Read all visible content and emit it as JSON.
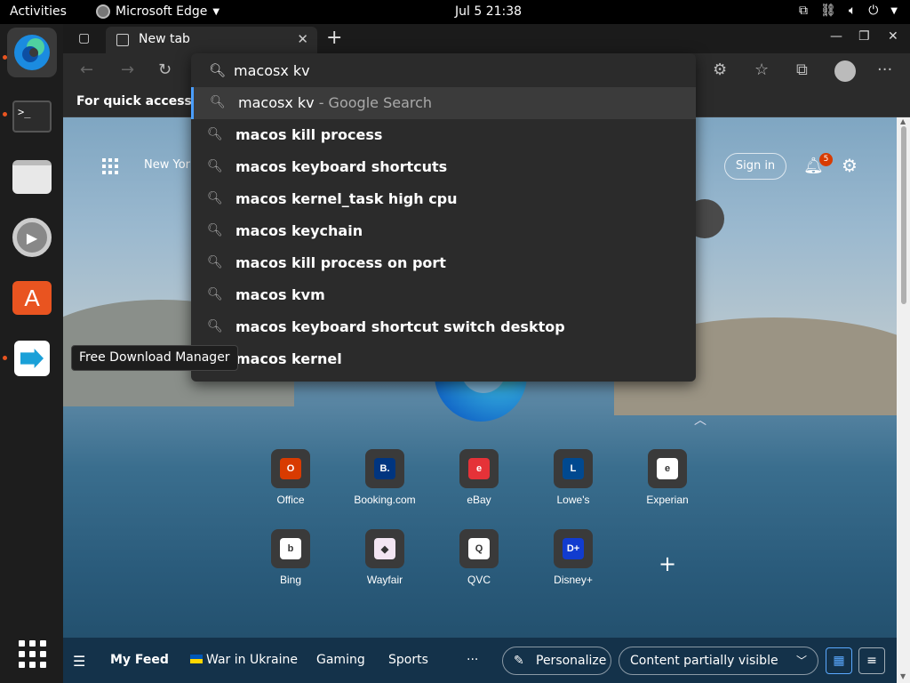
{
  "topbar": {
    "activities": "Activities",
    "app_name": "Microsoft Edge",
    "clock": "Jul 5  21:38"
  },
  "dock": {
    "items": [
      "edge-icon",
      "terminal-icon",
      "files-icon",
      "settings-icon",
      "software-icon",
      "free-download-manager-icon"
    ],
    "tooltip": "Free Download Manager"
  },
  "browser": {
    "tab_title": "New tab",
    "favorites_prompt": "For quick access, pl",
    "address": {
      "value": "macosx kv"
    },
    "suggestions": [
      {
        "text": "macosx kv",
        "suffix": " - Google Search"
      },
      {
        "text": "macos kill process",
        "suffix": ""
      },
      {
        "text": "macos keyboard shortcuts",
        "suffix": ""
      },
      {
        "text": "macos kernel_task high cpu",
        "suffix": ""
      },
      {
        "text": "macos keychain",
        "suffix": ""
      },
      {
        "text": "macos kill process on port",
        "suffix": ""
      },
      {
        "text": "macos kvm",
        "suffix": ""
      },
      {
        "text": "macos keyboard shortcut switch desktop",
        "suffix": ""
      },
      {
        "text": "macos kernel",
        "suffix": ""
      }
    ]
  },
  "newtab": {
    "weather": "New York",
    "sign_in": "Sign in",
    "notifications_count": "5",
    "quick_links": [
      {
        "label": "Office",
        "glyph": "O",
        "color": "#d83b01"
      },
      {
        "label": "Booking.com",
        "glyph": "B.",
        "color": "#003580"
      },
      {
        "label": "eBay",
        "glyph": "e",
        "color": "#e53238"
      },
      {
        "label": "Lowe's",
        "glyph": "L",
        "color": "#004990"
      },
      {
        "label": "Experian",
        "glyph": "e",
        "color": "#ffffff"
      },
      {
        "label": "Bing",
        "glyph": "b",
        "color": "#ffffff"
      },
      {
        "label": "Wayfair",
        "glyph": "◆",
        "color": "#f2e5f2"
      },
      {
        "label": "QVC",
        "glyph": "Q",
        "color": "#ffffff"
      },
      {
        "label": "Disney+",
        "glyph": "D+",
        "color": "#113ccf"
      }
    ],
    "feed": {
      "my_feed": "My Feed",
      "war_in_ukraine": "War in Ukraine",
      "gaming": "Gaming",
      "sports": "Sports",
      "more": "···",
      "personalize": "Personalize",
      "content_visibility": "Content partially visible"
    }
  }
}
